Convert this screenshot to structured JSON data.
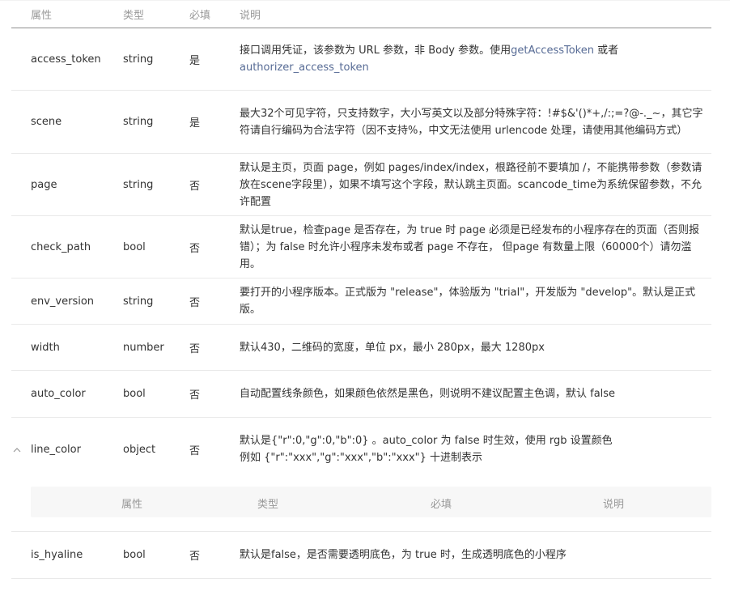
{
  "table": {
    "headers": [
      "属性",
      "类型",
      "必填",
      "说明"
    ],
    "rows": [
      {
        "name": "access_token",
        "type": "string",
        "required": "是",
        "desc": "接口调用凭证，该参数为 URL 参数，非 Body 参数。使用",
        "link1": "getAccessToken",
        "desc_mid": " 或者 ",
        "link2": "authorizer_access_token"
      },
      {
        "name": "scene",
        "type": "string",
        "required": "是",
        "desc": "最大32个可见字符，只支持数字，大小写英文以及部分特殊字符：!#$&'()*+,/:;=?@-._~，其它字符请自行编码为合法字符（因不支持%，中文无法使用 urlencode 处理，请使用其他编码方式）"
      },
      {
        "name": "page",
        "type": "string",
        "required": "否",
        "desc": "默认是主页，页面 page，例如 pages/index/index，根路径前不要填加 /，不能携带参数（参数请放在scene字段里），如果不填写这个字段，默认跳主页面。scancode_time为系统保留参数，不允许配置"
      },
      {
        "name": "check_path",
        "type": "bool",
        "required": "否",
        "desc": "默认是true，检查page 是否存在，为 true 时 page 必须是已经发布的小程序存在的页面（否则报错）；为 false 时允许小程序未发布或者 page 不存在， 但page 有数量上限（60000个）请勿滥用。"
      },
      {
        "name": "env_version",
        "type": "string",
        "required": "否",
        "desc": "要打开的小程序版本。正式版为 \"release\"，体验版为 \"trial\"，开发版为 \"develop\"。默认是正式版。"
      },
      {
        "name": "width",
        "type": "number",
        "required": "否",
        "desc": "默认430，二维码的宽度，单位 px，最小 280px，最大 1280px"
      },
      {
        "name": "auto_color",
        "type": "bool",
        "required": "否",
        "desc": "自动配置线条颜色，如果颜色依然是黑色，则说明不建议配置主色调，默认 false"
      },
      {
        "name": "line_color",
        "type": "object",
        "required": "否",
        "desc": "默认是{\"r\":0,\"g\":0,\"b\":0} 。auto_color 为 false 时生效，使用 rgb 设置颜色 例如 {\"r\":\"xxx\",\"g\":\"xxx\",\"b\":\"xxx\"} 十进制表示"
      },
      {
        "name": "is_hyaline",
        "type": "bool",
        "required": "否",
        "desc": "默认是false，是否需要透明底色，为 true 时，生成透明底色的小程序"
      }
    ],
    "nested_headers": [
      "属性",
      "类型",
      "必填",
      "说明"
    ],
    "expand_icon": "chevron-up-icon"
  }
}
